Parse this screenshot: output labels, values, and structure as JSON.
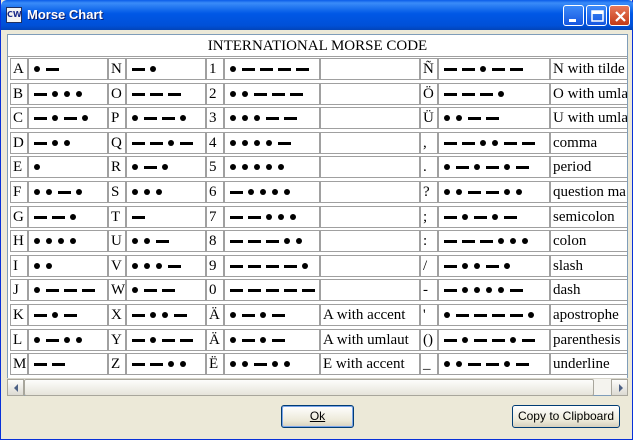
{
  "window": {
    "title": "Morse Chart",
    "icon": "app-icon"
  },
  "chart": {
    "title": "INTERNATIONAL MORSE CODE",
    "rows": [
      {
        "c1": "A",
        "m1": ".-",
        "c2": "N",
        "m2": "-.",
        "c3": "1",
        "m3": ".----",
        "c4": "",
        "m4": "",
        "d4": "",
        "c5": "Ñ",
        "m5": "--.--",
        "d5": "N with tilde"
      },
      {
        "c1": "B",
        "m1": "-...",
        "c2": "O",
        "m2": "---",
        "c3": "2",
        "m3": "..---",
        "c4": "",
        "m4": "",
        "d4": "",
        "c5": "Ö",
        "m5": "---.",
        "d5": "O with umla"
      },
      {
        "c1": "C",
        "m1": "-.-.",
        "c2": "P",
        "m2": ".--.",
        "c3": "3",
        "m3": "...--",
        "c4": "",
        "m4": "",
        "d4": "",
        "c5": "Ü",
        "m5": "..--",
        "d5": "U with umla"
      },
      {
        "c1": "D",
        "m1": "-..",
        "c2": "Q",
        "m2": "--.-",
        "c3": "4",
        "m3": "....-",
        "c4": "",
        "m4": "",
        "d4": "",
        "c5": ",",
        "m5": "--..--",
        "d5": "comma"
      },
      {
        "c1": "E",
        "m1": ".",
        "c2": "R",
        "m2": ".-.",
        "c3": "5",
        "m3": ".....",
        "c4": "",
        "m4": "",
        "d4": "",
        "c5": ".",
        "m5": ".-.-.-",
        "d5": "period"
      },
      {
        "c1": "F",
        "m1": "..-.",
        "c2": "S",
        "m2": "...",
        "c3": "6",
        "m3": "-....",
        "c4": "",
        "m4": "",
        "d4": "",
        "c5": "?",
        "m5": "..--..",
        "d5": "question ma"
      },
      {
        "c1": "G",
        "m1": "--.",
        "c2": "T",
        "m2": "-",
        "c3": "7",
        "m3": "--...",
        "c4": "",
        "m4": "",
        "d4": "",
        "c5": ";",
        "m5": "-.-.-",
        "d5": "semicolon"
      },
      {
        "c1": "H",
        "m1": "....",
        "c2": "U",
        "m2": "..-",
        "c3": "8",
        "m3": "---..",
        "c4": "",
        "m4": "",
        "d4": "",
        "c5": ":",
        "m5": "---...",
        "d5": "colon"
      },
      {
        "c1": "I",
        "m1": "..",
        "c2": "V",
        "m2": "...-",
        "c3": "9",
        "m3": "----.",
        "c4": "",
        "m4": "",
        "d4": "",
        "c5": "/",
        "m5": "-..-.",
        "d5": "slash"
      },
      {
        "c1": "J",
        "m1": ".---",
        "c2": "W",
        "m2": ".--",
        "c3": "0",
        "m3": "-----",
        "c4": "",
        "m4": "",
        "d4": "",
        "c5": "-",
        "m5": "-....-",
        "d5": "dash"
      },
      {
        "c1": "K",
        "m1": "-.-",
        "c2": "X",
        "m2": "-..-",
        "c3": "Ä",
        "m3": ".-.-",
        "c4": "",
        "m4": "",
        "d4": "A with accent",
        "c5": "'",
        "m5": ".----.",
        "d5": "apostrophe"
      },
      {
        "c1": "L",
        "m1": ".-..",
        "c2": "Y",
        "m2": "-.--",
        "c3": "Ä",
        "m3": ".-.-",
        "c4": "",
        "m4": "",
        "d4": "A with umlaut",
        "c5": "()",
        "m5": "-.--.-",
        "d5": "parenthesis"
      },
      {
        "c1": "M",
        "m1": "--",
        "c2": "Z",
        "m2": "--..",
        "c3": "Ë",
        "m3": "..-..",
        "c4": "",
        "m4": "",
        "d4": "E with accent",
        "c5": "_",
        "m5": "..--.-",
        "d5": "underline"
      }
    ]
  },
  "buttons": {
    "ok": "Ok",
    "copy": "Copy to Clipboard"
  }
}
